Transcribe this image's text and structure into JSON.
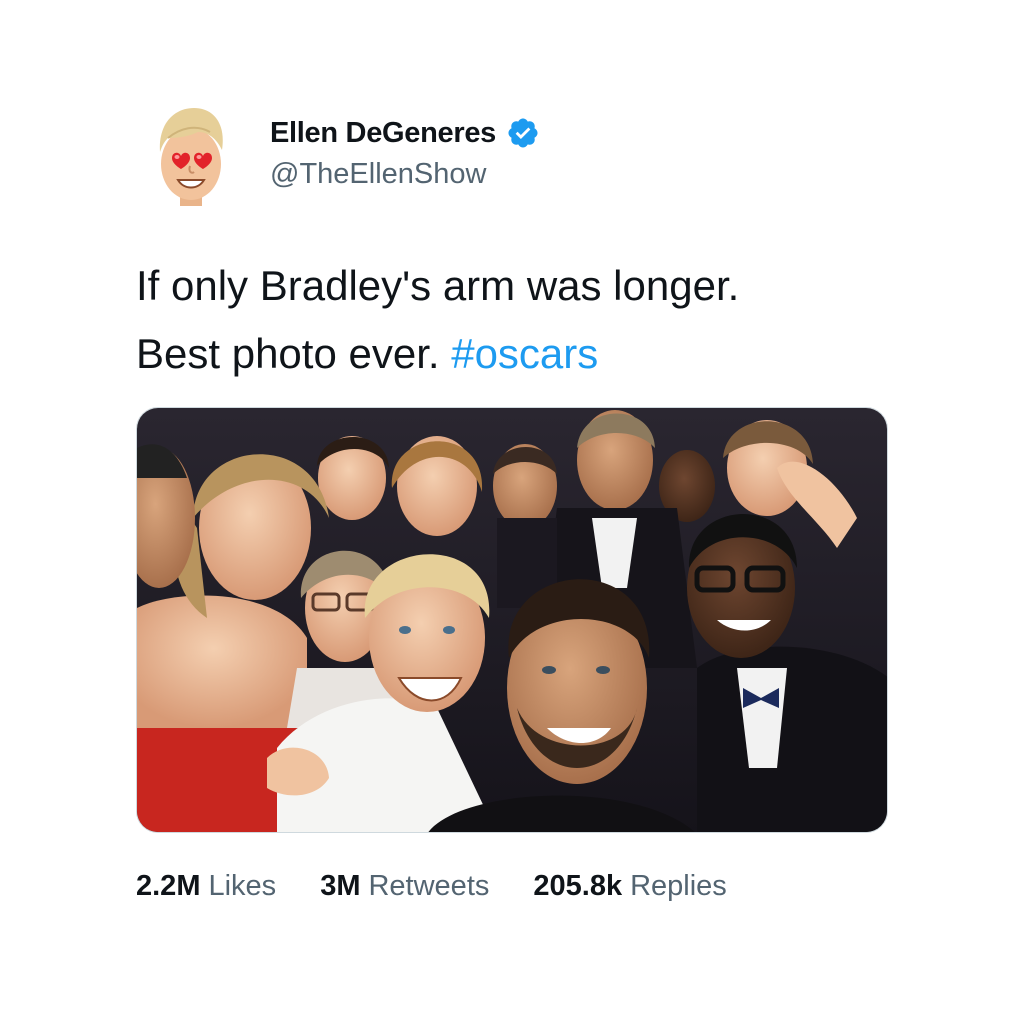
{
  "author": {
    "display_name": "Ellen DeGeneres",
    "handle": "@TheEllenShow",
    "verified": true,
    "avatar_icon": "heart-eyes-cartoon-avatar-icon",
    "verified_color": "#1d9bf0"
  },
  "tweet": {
    "text_line1": "If only Bradley's arm was longer.",
    "text_line2_prefix": "Best photo ever.",
    "hashtag": "#oscars",
    "hashtag_color": "#1d9bf0"
  },
  "media": {
    "alt": "Group selfie at the Oscars"
  },
  "stats": {
    "likes_count": "2.2M",
    "likes_label": "Likes",
    "retweets_count": "3M",
    "retweets_label": "Retweets",
    "replies_count": "205.8k",
    "replies_label": "Replies"
  }
}
